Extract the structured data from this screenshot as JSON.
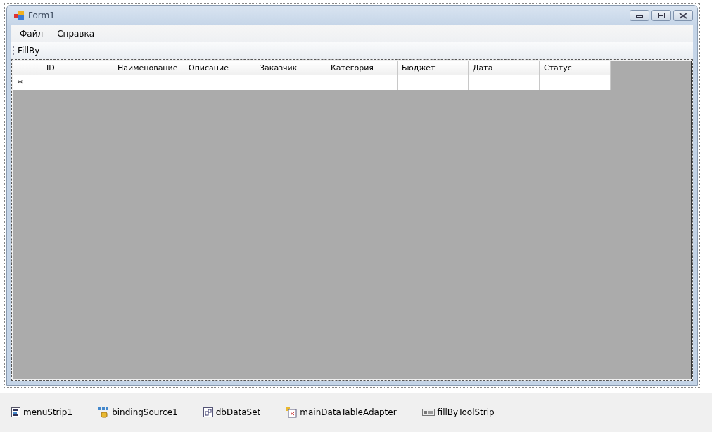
{
  "window": {
    "title": "Form1"
  },
  "menu": [
    "Файл",
    "Справка"
  ],
  "toolstrip": {
    "label": "FillBy"
  },
  "grid": {
    "columns": [
      "ID",
      "Наименование",
      "Описание",
      "Заказчик",
      "Категория",
      "Бюджет",
      "Дата",
      "Статус"
    ],
    "new_row_marker": "*"
  },
  "tray": [
    {
      "label": "menuStrip1",
      "kind": "menu"
    },
    {
      "label": "bindingSource1",
      "kind": "binding"
    },
    {
      "label": "dbDataSet",
      "kind": "dataset"
    },
    {
      "label": "mainDataTableAdapter",
      "kind": "adapter"
    },
    {
      "label": "fillByToolStrip",
      "kind": "toolstrip"
    }
  ]
}
